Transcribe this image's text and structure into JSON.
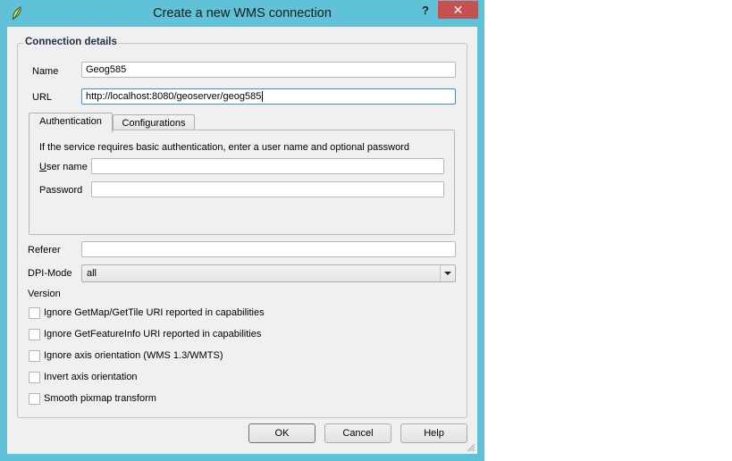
{
  "window": {
    "title": "Create a new WMS connection",
    "help_label": "?",
    "close_label": "✕"
  },
  "group": {
    "title": "Connection details"
  },
  "fields": {
    "name_label": "Name",
    "name_value": "Geog585",
    "url_label": "URL",
    "url_value": "http://localhost:8080/geoserver/geog585",
    "referer_label": "Referer",
    "referer_value": "",
    "dpi_label": "DPI-Mode",
    "dpi_value": "all",
    "version_label": "Version"
  },
  "tabs": [
    {
      "label": "Authentication",
      "active": true
    },
    {
      "label": "Configurations",
      "active": false
    }
  ],
  "auth": {
    "info": "If the service requires basic authentication, enter a user name and optional password",
    "username_label_first": "U",
    "username_label_rest": "ser name",
    "username_value": "",
    "password_label": "Password",
    "password_value": ""
  },
  "options": [
    {
      "label": "Ignore GetMap/GetTile URI reported in capabilities",
      "checked": false
    },
    {
      "label": "Ignore GetFeatureInfo URI reported in capabilities",
      "checked": false
    },
    {
      "label": "Ignore axis orientation (WMS 1.3/WMTS)",
      "checked": false
    },
    {
      "label": "Invert axis orientation",
      "checked": false
    },
    {
      "label": "Smooth pixmap transform",
      "checked": false
    }
  ],
  "buttons": {
    "ok": "OK",
    "cancel": "Cancel",
    "help": "Help"
  },
  "colors": {
    "titlebar": "#5fc2d8",
    "close": "#c75050",
    "focus": "#3c8fd4"
  }
}
